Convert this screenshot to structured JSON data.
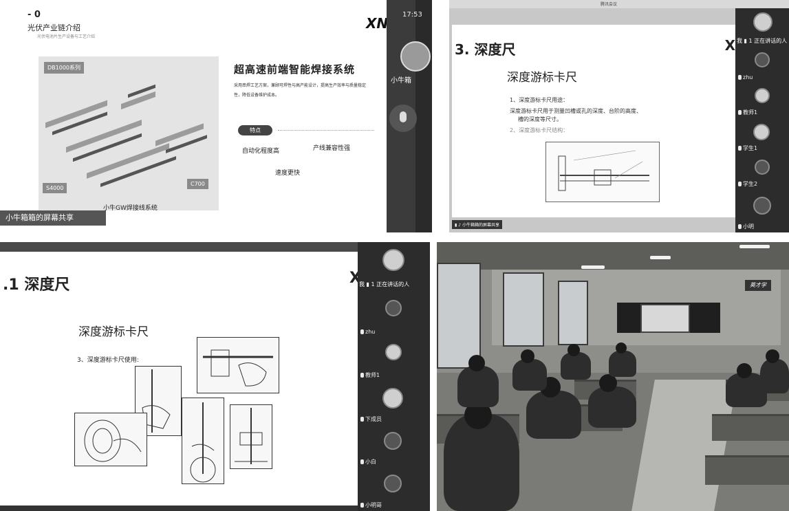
{
  "panel1": {
    "heading_num": "- 0",
    "title": "光伏产业链介绍",
    "subtitle": "光伏电池片生产设备与工艺介绍",
    "logo": "XN",
    "time": "17:53",
    "camera_label": "小牛箱",
    "diagram_tags": [
      "DB1000系列",
      "S4000",
      "C700"
    ],
    "diagram_caption": "小牛GW焊接线系统",
    "heading": "超高速前端智能焊接系统",
    "description": "采用串焊工艺方案，兼顾可焊性与高产能设计，提高生产效率与质量稳定性，降低设备维护成本。",
    "feature_button": "特点",
    "features": [
      "自动化程度高",
      "产线兼容性强",
      "速度更快"
    ],
    "share_label": "小牛箱箱的屏幕共享"
  },
  "panel2": {
    "window_title": "腾讯会议",
    "heading": "3. 深度尺",
    "logo": "X",
    "slide_title": "深度游标卡尺",
    "items": [
      "1、深度游标卡尺用途：",
      "深度游标卡尺用于测量凹槽或孔的深度、台阶的高度、",
      "槽的深度等尺寸。",
      "2、深度游标卡尺结构："
    ],
    "side_top_label": "我 ▮ 1 正在讲话的人",
    "participants": [
      {
        "name": "zhu"
      },
      {
        "name": "教师1"
      },
      {
        "name": "学生1"
      },
      {
        "name": "学生2"
      },
      {
        "name": "小明"
      }
    ],
    "bottom_label": "▮ ♪ 小牛箱箱的屏幕共享"
  },
  "panel3": {
    "heading": ".1 深度尺",
    "logo": "X",
    "slide_title": "深度游标卡尺",
    "step": "3、深度游标卡尺使用:",
    "side_top_label": "我 ▮ 1 正在讲话的人",
    "participants": [
      {
        "name": "zhu"
      },
      {
        "name": "教师1"
      },
      {
        "name": "下成员"
      },
      {
        "name": "小白"
      },
      {
        "name": "小明哥"
      }
    ]
  },
  "panel4": {
    "sign_text": "英才学"
  }
}
